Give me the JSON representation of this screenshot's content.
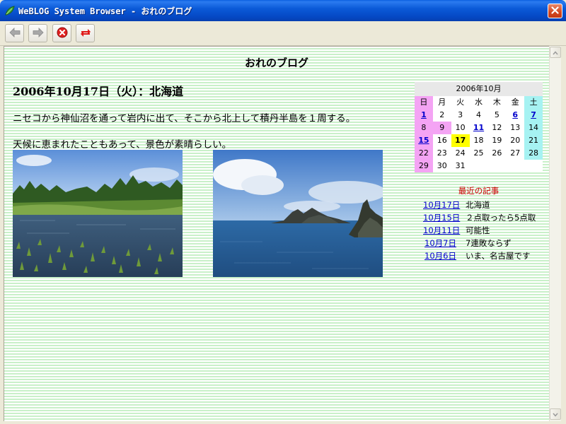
{
  "window": {
    "title": "WeBLOG System Browser - おれのブログ"
  },
  "blog": {
    "title": "おれのブログ",
    "post_heading": "2006年10月17日（火）：北海道",
    "paragraph1": "ニセコから神仙沼を通って岩内に出て、そこから北上して積丹半島を１周する。",
    "paragraph2": "天候に恵まれたこともあって、景色が素晴らしい。"
  },
  "calendar": {
    "caption": "2006年10月",
    "weekdays": [
      "日",
      "月",
      "火",
      "水",
      "木",
      "金",
      "土"
    ],
    "weeks": [
      [
        {
          "d": "1",
          "link": true
        },
        {
          "d": "2"
        },
        {
          "d": "3"
        },
        {
          "d": "4"
        },
        {
          "d": "5"
        },
        {
          "d": "6",
          "link": true
        },
        {
          "d": "7",
          "link": true
        }
      ],
      [
        {
          "d": "8"
        },
        {
          "d": "9",
          "pink": true
        },
        {
          "d": "10"
        },
        {
          "d": "11",
          "link": true
        },
        {
          "d": "12"
        },
        {
          "d": "13"
        },
        {
          "d": "14"
        }
      ],
      [
        {
          "d": "15",
          "link": true
        },
        {
          "d": "16"
        },
        {
          "d": "17",
          "today": true
        },
        {
          "d": "18"
        },
        {
          "d": "19"
        },
        {
          "d": "20"
        },
        {
          "d": "21"
        }
      ],
      [
        {
          "d": "22"
        },
        {
          "d": "23"
        },
        {
          "d": "24"
        },
        {
          "d": "25"
        },
        {
          "d": "26"
        },
        {
          "d": "27"
        },
        {
          "d": "28"
        }
      ],
      [
        {
          "d": "29"
        },
        {
          "d": "30"
        },
        {
          "d": "31"
        },
        {
          "d": ""
        },
        {
          "d": ""
        },
        {
          "d": ""
        },
        {
          "d": ""
        }
      ]
    ]
  },
  "recent": {
    "title": "最近の記事",
    "items": [
      {
        "date": "10月17日",
        "name": "北海道"
      },
      {
        "date": "10月15日",
        "name": "２点取ったら5点取"
      },
      {
        "date": "10月11日",
        "name": "可能性"
      },
      {
        "date": "10月7日",
        "name": "7連敗ならず"
      },
      {
        "date": "10月6日",
        "name": "いま、名古屋です"
      }
    ]
  },
  "icons": {
    "app": "leaf-app-icon",
    "close": "close-icon",
    "back": "back-arrow-icon",
    "forward": "forward-arrow-icon",
    "stop": "stop-icon",
    "refresh": "refresh-icon"
  },
  "colors": {
    "titlebar": "#0b5ad8",
    "sunday": "#f4a4f4",
    "saturday": "#a6f2f2",
    "today": "#ffff00",
    "link": "#0000cc",
    "recent_title": "#cc0000"
  }
}
